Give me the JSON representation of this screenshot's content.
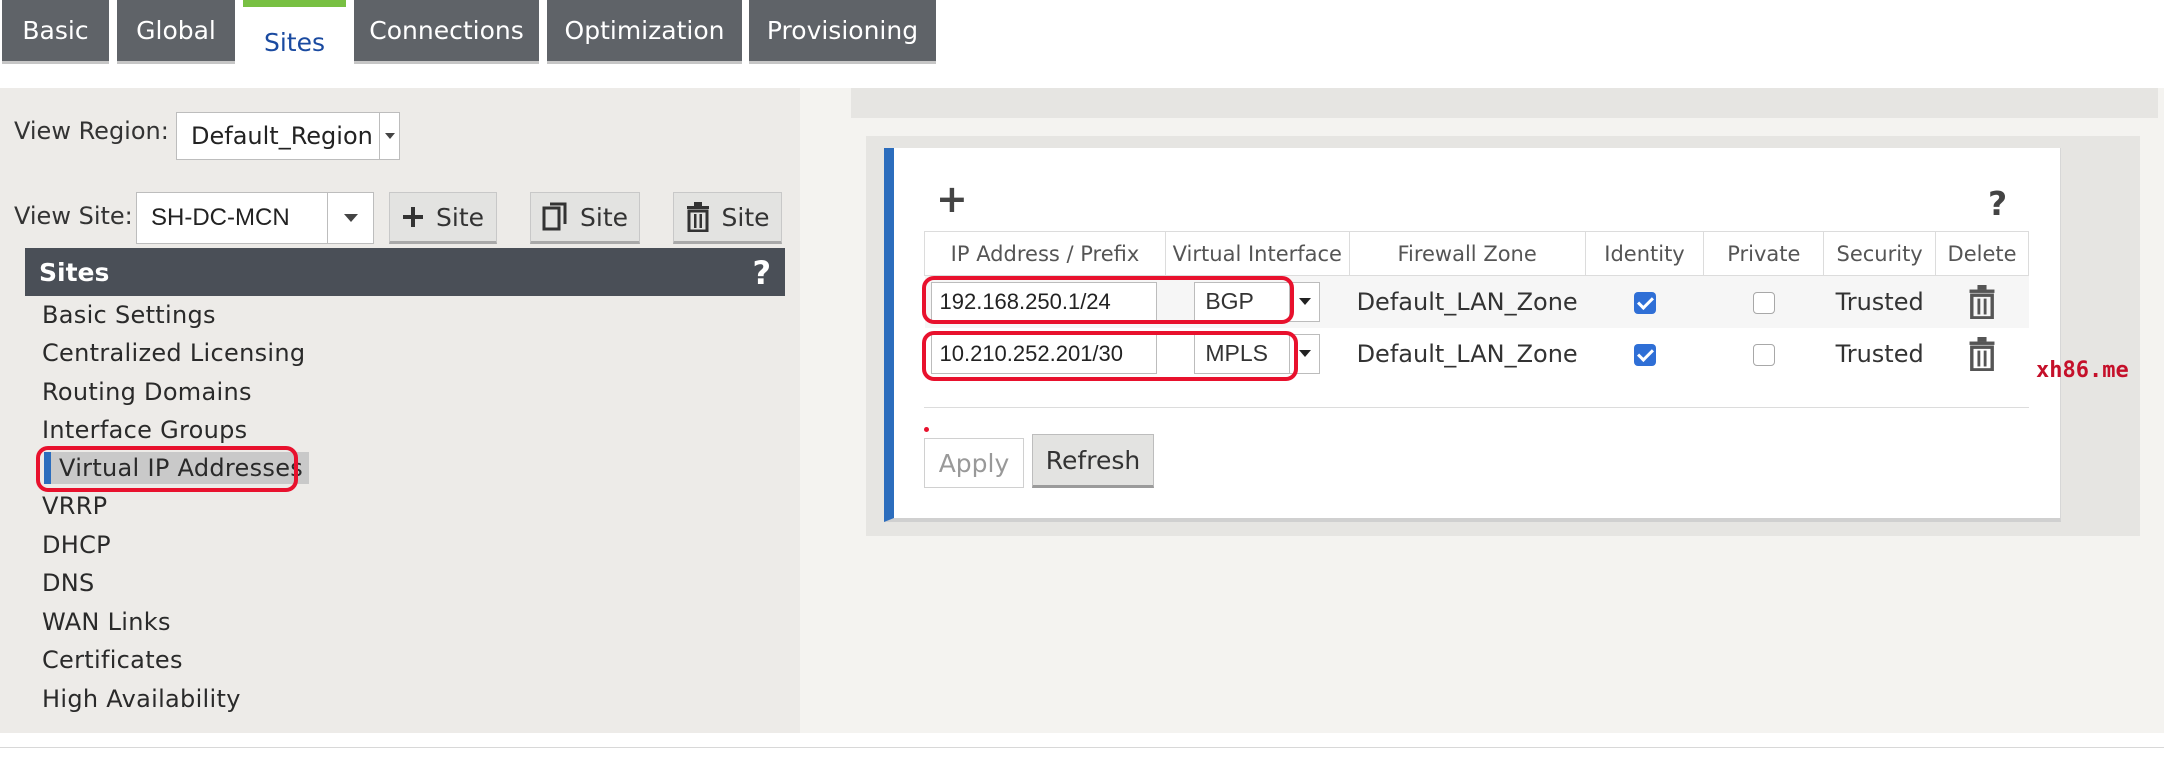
{
  "tabs": [
    {
      "label": "Basic",
      "active": false
    },
    {
      "label": "Global",
      "active": false
    },
    {
      "label": "Sites",
      "active": true
    },
    {
      "label": "Connections",
      "active": false
    },
    {
      "label": "Optimization",
      "active": false
    },
    {
      "label": "Provisioning",
      "active": false
    }
  ],
  "left": {
    "view_region_label": "View Region:",
    "view_region_value": "Default_Region",
    "view_site_label": "View Site:",
    "view_site_value": "SH-DC-MCN",
    "add_site_label": "Site",
    "clone_site_label": "Site",
    "delete_site_label": "Site"
  },
  "sites_panel": {
    "title": "Sites",
    "help": "?",
    "items": [
      "Basic Settings",
      "Centralized Licensing",
      "Routing Domains",
      "Interface Groups",
      "Virtual IP Addresses",
      "VRRP",
      "DHCP",
      "DNS",
      "WAN Links",
      "Certificates",
      "High Availability"
    ],
    "selected_index": 4
  },
  "vip_panel": {
    "add": "+",
    "help": "?",
    "columns": [
      "IP Address / Prefix",
      "Virtual Interface",
      "Firewall Zone",
      "Identity",
      "Private",
      "Security",
      "Delete"
    ],
    "rows": [
      {
        "ip": "192.168.250.1/24",
        "interface": "BGP",
        "zone": "Default_LAN_Zone",
        "identity": true,
        "private": false,
        "security": "Trusted"
      },
      {
        "ip": "10.210.252.201/30",
        "interface": "MPLS",
        "zone": "Default_LAN_Zone",
        "identity": true,
        "private": false,
        "security": "Trusted"
      }
    ],
    "apply_label": "Apply",
    "refresh_label": "Refresh"
  },
  "watermark": "xh86.me",
  "colors": {
    "tab_bg": "#5f6368",
    "active_tab_accent": "#78c043",
    "selection_blue": "#2c6dbd",
    "highlight_red": "#e8112d",
    "checkbox_blue": "#2f6fd6"
  }
}
